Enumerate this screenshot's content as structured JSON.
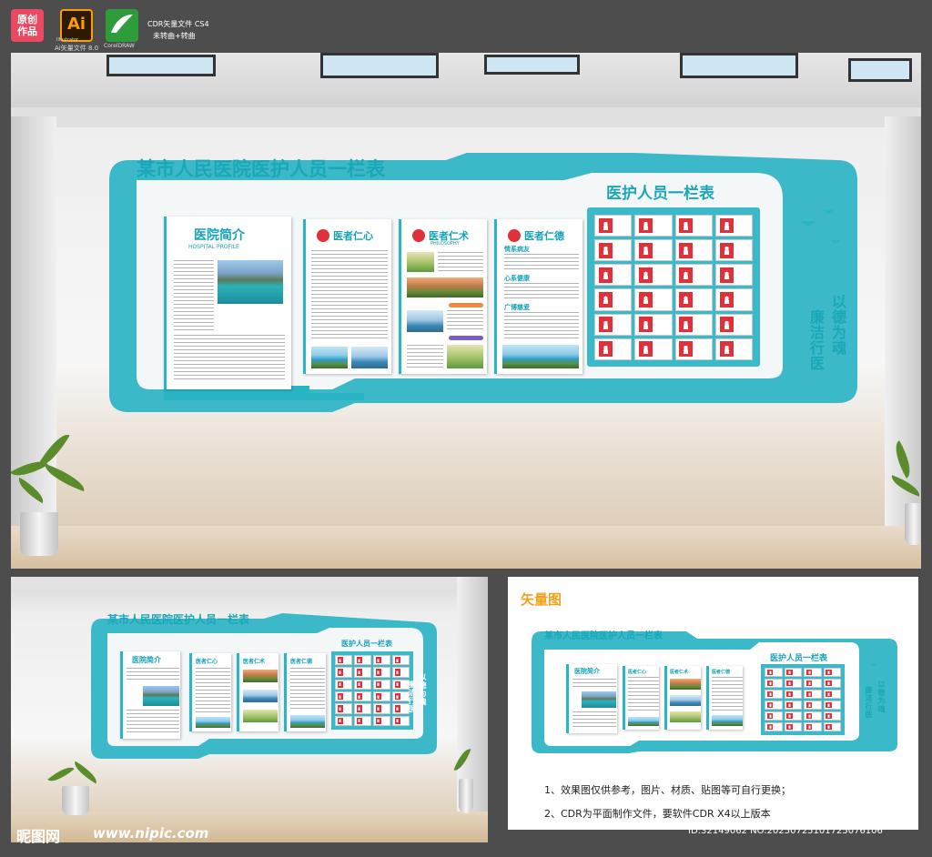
{
  "header": {
    "original_badge": "原创\n作品",
    "ai_badge": "Ai",
    "ai_caption": "Ai矢量文件 8.0",
    "ai_sub": "Illustrator",
    "cdr_caption": "CorelDRAW",
    "cdr_line1": "CDR矢量文件 CS4",
    "cdr_line2": "未转曲+转曲"
  },
  "board": {
    "title": "某市人民医院医护人员一栏表",
    "intro_title": "医院简介",
    "intro_sub": "HOSPITAL PROFILE",
    "card2_title": "医者仁心",
    "card3_title": "医者仁术",
    "card3_sub": "PHILOSOPHY",
    "card4_title": "医者仁德",
    "card4_items": [
      "情系病友",
      "心系健康",
      "广博慈爱"
    ],
    "staff_title": "医护人员一栏表",
    "slogan_line1": "以德为魂",
    "slogan_line2": "廉洁行医"
  },
  "vector_panel": {
    "label": "矢量图",
    "note1": "1、效果图仅供参考，图片、材质、贴图等可自行更换；",
    "note2": "2、CDR为平面制作文件，要软件CDR X4以上版本"
  },
  "watermark": {
    "site": "昵图网",
    "url": "www.nipic.com",
    "id": "ID:32149062 NO:20250725101725076106"
  },
  "colors": {
    "teal": "#2ab5c4",
    "staff_red": "#e0303a",
    "vector_label": "#f0a21a"
  }
}
